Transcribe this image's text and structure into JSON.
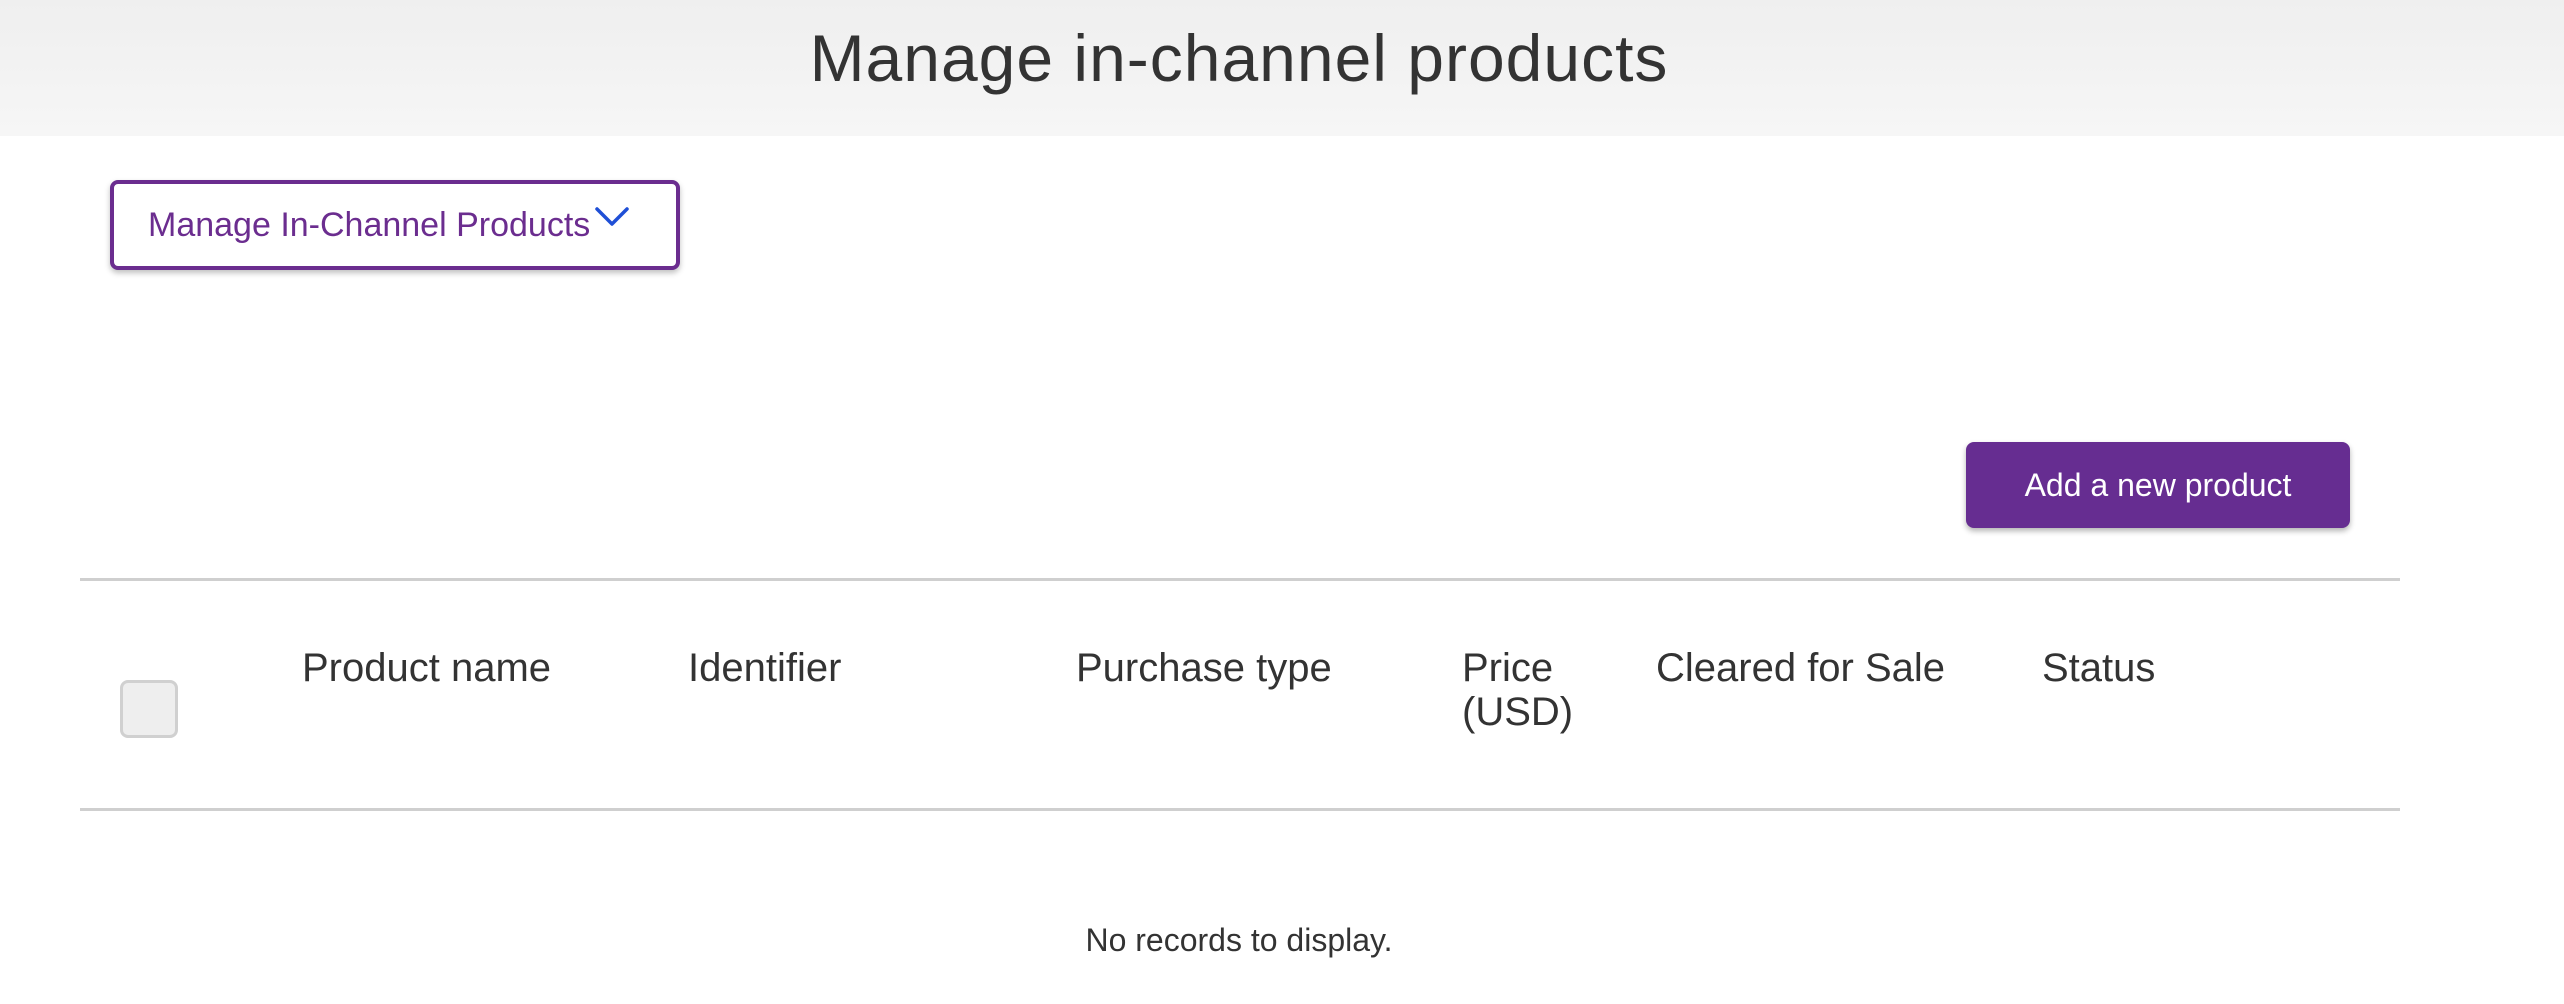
{
  "header": {
    "title": "Manage in-channel products"
  },
  "menu": {
    "label": "Manage In-Channel Products",
    "icon": "chevron-down-icon"
  },
  "actions": {
    "add_product_label": "Add a new product"
  },
  "table": {
    "columns": [
      "Product name",
      "Identifier",
      "Purchase type",
      "Price (USD)",
      "Cleared for Sale",
      "Status"
    ],
    "price_header_line1": "Price",
    "price_header_line2": "(USD)",
    "select_all_checked": false,
    "rows": [],
    "empty_message": "No records to display."
  },
  "colors": {
    "accent": "#662d91",
    "chevron": "#1f4fd6",
    "divider": "#cfcfcf",
    "header_bg": "#f2f2f2"
  }
}
